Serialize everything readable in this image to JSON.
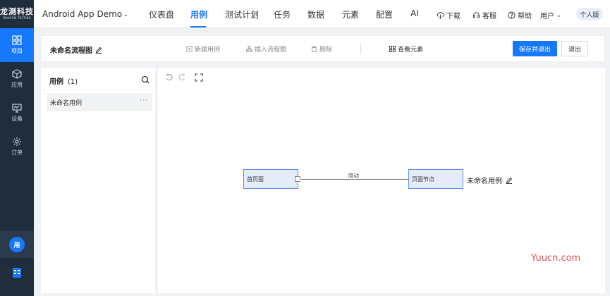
{
  "sidebar": {
    "logo_main": "龙测科技",
    "logo_sub": "DRAGON TESTING",
    "items": [
      {
        "label": "项目",
        "icon": "grid-icon",
        "active": true
      },
      {
        "label": "应用",
        "icon": "cube-icon",
        "active": false
      },
      {
        "label": "设备",
        "icon": "monitor-icon",
        "active": false
      },
      {
        "label": "订单",
        "icon": "gear-icon",
        "active": false
      }
    ],
    "avatar_text": "用"
  },
  "header": {
    "project_title": "Android App Demo",
    "tabs": [
      {
        "label": "仪表盘",
        "active": false
      },
      {
        "label": "用例",
        "active": true
      },
      {
        "label": "测试计划",
        "active": false
      },
      {
        "label": "任务",
        "active": false
      },
      {
        "label": "数据",
        "active": false
      },
      {
        "label": "元素",
        "active": false
      },
      {
        "label": "配置",
        "active": false
      },
      {
        "label": "AI",
        "active": false
      }
    ],
    "actions": {
      "download": "下载",
      "service": "客服",
      "help": "帮助",
      "user": "用户"
    },
    "edition": "个人版"
  },
  "toolbar": {
    "flow_name": "未命名流程图",
    "new_case": "新建用例",
    "insert_flow": "插入流程图",
    "delete": "删除",
    "view_elements": "查看元素",
    "save_exit": "保存并退出",
    "exit": "退出"
  },
  "case_panel": {
    "title": "用例",
    "count": "(1)",
    "items": [
      {
        "label": "未命名用例"
      }
    ],
    "more": "···"
  },
  "canvas": {
    "nodes": [
      {
        "label": "首页面"
      },
      {
        "label": "页面节点"
      }
    ],
    "edge_label": "滑动",
    "case_label": "未命名用例"
  },
  "watermark": "Yuucn.com",
  "colors": {
    "primary": "#1677ff",
    "sidebar_bg": "#1f2d3d",
    "node_fill": "#e3ecf8",
    "node_border": "#5b8def"
  }
}
